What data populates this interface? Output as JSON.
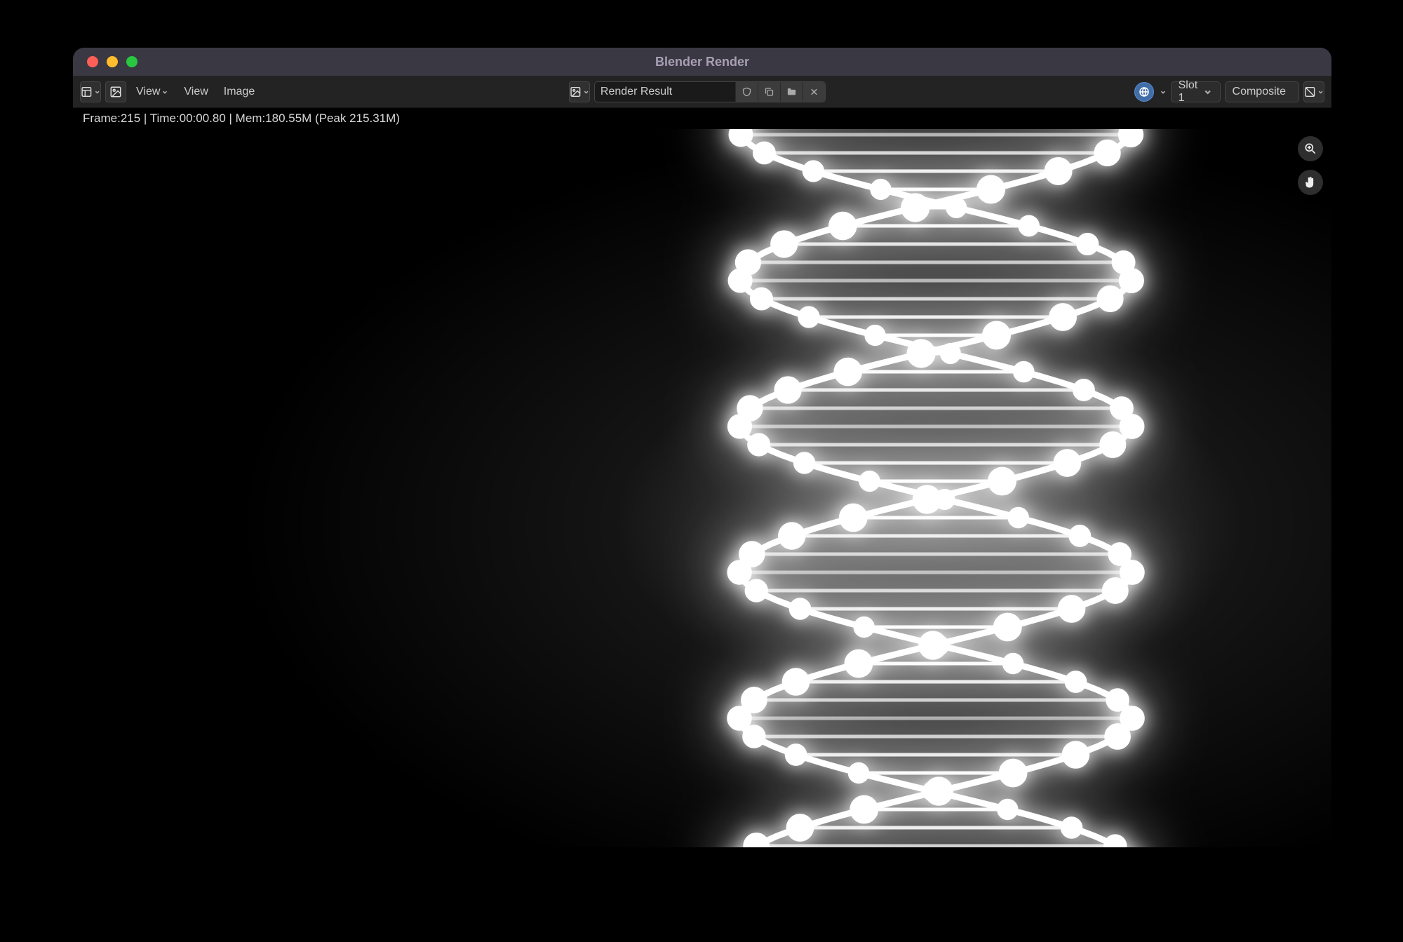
{
  "window": {
    "title": "Blender Render"
  },
  "toolbar": {
    "menu_view": "View",
    "menu_view2": "View",
    "menu_image": "Image",
    "render_result": "Render Result",
    "slot": "Slot 1",
    "pass": "Composite"
  },
  "status": {
    "text": "Frame:215 | Time:00:00.80 | Mem:180.55M (Peak 215.31M)"
  },
  "icons": {
    "editor_type": "editor-type-icon",
    "image_mode": "image-mode-icon",
    "browse_image": "image-browse-icon",
    "fake_user": "shield-icon",
    "new": "duplicate-icon",
    "open": "folder-icon",
    "unlink": "close-icon",
    "scene_world": "scene-icon",
    "display_channels": "channels-icon",
    "zoom": "zoom-icon",
    "pan": "hand-icon"
  }
}
